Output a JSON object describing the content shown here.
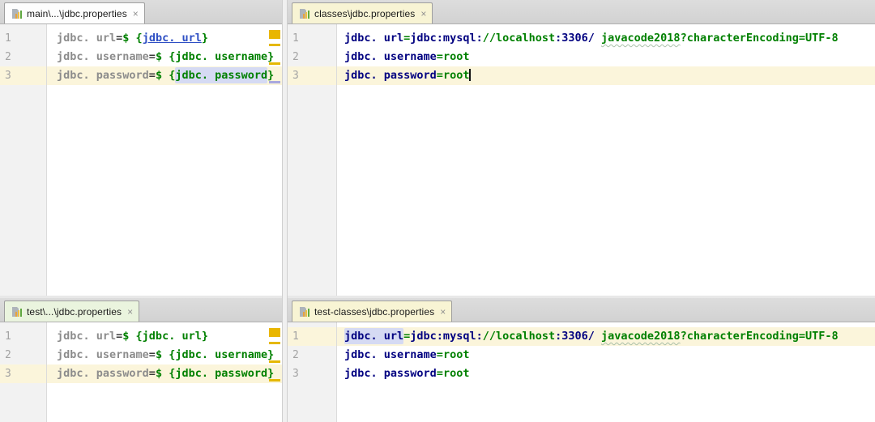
{
  "colors": {
    "editor_bg": "#FFFFFF",
    "gutter_bg": "#F2F2F2",
    "current_line_highlight": "#FBF5DB",
    "property_key_navy": "#000080",
    "property_value_green": "#008000",
    "unused_key_gray": "#8C8C8C",
    "reference_link_blue": "#2E4FC4",
    "usage_highlight_lavender": "#D5DAF3",
    "warning_mark_gold": "#E9B600",
    "caret_mark_lavender": "#A9A8DF",
    "tab_scope_yellow": "#F8F4D4",
    "tab_scope_green": "#EAF4DE",
    "tab_plain": "#FDFDFD"
  },
  "panes": [
    {
      "id": "main-source",
      "tab": {
        "label": "main\\...\\jdbc.properties",
        "close": "×",
        "color": "#FDFDFD",
        "icon": "properties-file-icon"
      },
      "lines": [
        {
          "no": "1",
          "current": false,
          "segments": [
            {
              "t": "jdbc. url",
              "s": "key"
            },
            {
              "t": "=",
              "s": "eq"
            },
            {
              "t": "$ {",
              "s": "val"
            },
            {
              "t": "jdbc. url",
              "s": "link"
            },
            {
              "t": "}",
              "s": "val"
            }
          ]
        },
        {
          "no": "2",
          "current": false,
          "segments": [
            {
              "t": "jdbc. username",
              "s": "key"
            },
            {
              "t": "=",
              "s": "eq"
            },
            {
              "t": "$ {jdbc. username}",
              "s": "val"
            }
          ]
        },
        {
          "no": "3",
          "current": true,
          "segments": [
            {
              "t": "jdbc. password",
              "s": "key"
            },
            {
              "t": "=",
              "s": "eq"
            },
            {
              "t": "$ {",
              "s": "val"
            },
            {
              "t": "jdbc. password",
              "s": "valhl"
            },
            {
              "t": "}",
              "s": "val"
            }
          ]
        }
      ],
      "marks": [
        {
          "line": 1,
          "kind": "square",
          "color": "#E9B600"
        },
        {
          "line": 1,
          "kind": "dash",
          "color": "#E5B800"
        },
        {
          "line": 2,
          "kind": "dash",
          "color": "#E5B800"
        },
        {
          "line": 3,
          "kind": "dash",
          "color": "#A9A8DF"
        }
      ]
    },
    {
      "id": "classes-output",
      "tab": {
        "label": "classes\\jdbc.properties",
        "close": "×",
        "color": "#F8F4D4",
        "icon": "properties-file-icon"
      },
      "lines": [
        {
          "no": "1",
          "current": false,
          "segments": [
            {
              "t": "jdbc. url",
              "s": "keyb"
            },
            {
              "t": "=",
              "s": "eqg"
            },
            {
              "t": "jdbc:mysql:",
              "s": "navy"
            },
            {
              "t": "//localhost",
              "s": "val"
            },
            {
              "t": ":3306/ ",
              "s": "navy"
            },
            {
              "t": "javacode2018",
              "s": "wavy"
            },
            {
              "t": "?characterEncoding=UTF-8",
              "s": "val"
            }
          ]
        },
        {
          "no": "2",
          "current": false,
          "segments": [
            {
              "t": "jdbc. username",
              "s": "keyb"
            },
            {
              "t": "=",
              "s": "eqg"
            },
            {
              "t": "root",
              "s": "val"
            }
          ]
        },
        {
          "no": "3",
          "current": true,
          "segments": [
            {
              "t": "jdbc. password",
              "s": "keyb"
            },
            {
              "t": "=",
              "s": "eqg"
            },
            {
              "t": "root",
              "s": "val"
            },
            {
              "t": "",
              "s": "caret"
            }
          ]
        }
      ],
      "marks": []
    },
    {
      "id": "test-source",
      "tab": {
        "label": "test\\...\\jdbc.properties",
        "close": "×",
        "color": "#EAF4DE",
        "icon": "properties-file-icon"
      },
      "lines": [
        {
          "no": "1",
          "current": false,
          "segments": [
            {
              "t": "jdbc. url",
              "s": "key"
            },
            {
              "t": "=",
              "s": "eq"
            },
            {
              "t": "$ {jdbc. url}",
              "s": "val"
            }
          ]
        },
        {
          "no": "2",
          "current": false,
          "segments": [
            {
              "t": "jdbc. username",
              "s": "key"
            },
            {
              "t": "=",
              "s": "eq"
            },
            {
              "t": "$ {jdbc. username}",
              "s": "val"
            }
          ]
        },
        {
          "no": "3",
          "current": true,
          "segments": [
            {
              "t": "jdbc. password",
              "s": "key"
            },
            {
              "t": "=",
              "s": "eq"
            },
            {
              "t": "$ {jdbc. password}",
              "s": "val"
            }
          ]
        }
      ],
      "marks": [
        {
          "line": 1,
          "kind": "square",
          "color": "#E9B600"
        },
        {
          "line": 1,
          "kind": "dash",
          "color": "#E5B800"
        },
        {
          "line": 2,
          "kind": "dash",
          "color": "#E5B800"
        },
        {
          "line": 3,
          "kind": "dash",
          "color": "#E5B800"
        }
      ]
    },
    {
      "id": "test-classes-output",
      "tab": {
        "label": "test-classes\\jdbc.properties",
        "close": "×",
        "color": "#F8F4D4",
        "icon": "properties-file-icon"
      },
      "lines": [
        {
          "no": "1",
          "current": true,
          "segments": [
            {
              "t": "jdbc. url",
              "s": "keybhl"
            },
            {
              "t": "=",
              "s": "eqg"
            },
            {
              "t": "jdbc:mysql:",
              "s": "navy"
            },
            {
              "t": "//localhost",
              "s": "val"
            },
            {
              "t": ":3306/ ",
              "s": "navy"
            },
            {
              "t": "javacode2018",
              "s": "wavy"
            },
            {
              "t": "?characterEncoding=UTF-8",
              "s": "val"
            }
          ]
        },
        {
          "no": "2",
          "current": false,
          "segments": [
            {
              "t": "jdbc. username",
              "s": "keyb"
            },
            {
              "t": "=",
              "s": "eqg"
            },
            {
              "t": "root",
              "s": "val"
            }
          ]
        },
        {
          "no": "3",
          "current": false,
          "segments": [
            {
              "t": "jdbc. password",
              "s": "keyb"
            },
            {
              "t": "=",
              "s": "eqg"
            },
            {
              "t": "root",
              "s": "val"
            }
          ]
        }
      ],
      "marks": []
    }
  ]
}
